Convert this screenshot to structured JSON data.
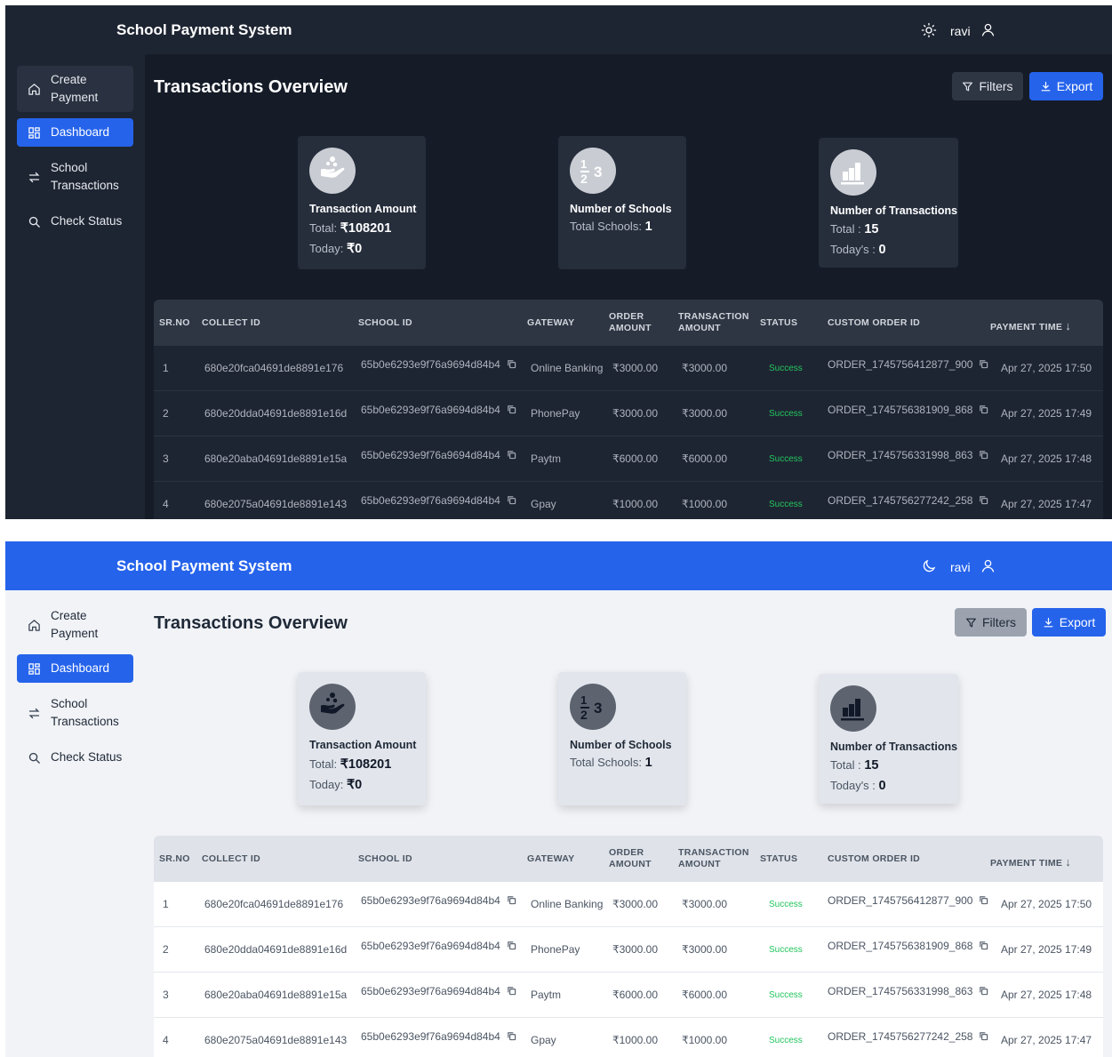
{
  "app_title": "School Payment System",
  "user": {
    "name": "ravi"
  },
  "sidebar": {
    "items": [
      {
        "label": "Create Payment",
        "icon": "home-icon"
      },
      {
        "label": "Dashboard",
        "icon": "dashboard-icon"
      },
      {
        "label": "School Transactions",
        "icon": "arrows-swap-icon"
      },
      {
        "label": "Check Status",
        "icon": "search-icon"
      }
    ]
  },
  "page_title": "Transactions Overview",
  "toolbar": {
    "filters_label": "Filters",
    "export_label": "Export"
  },
  "cards": {
    "amount": {
      "title": "Transaction Amount",
      "total_label": "Total:",
      "total_value": "₹108201",
      "today_label": "Today:",
      "today_value": "₹0"
    },
    "schools": {
      "title": "Number of Schools",
      "total_label": "Total Schools:",
      "total_value": "1"
    },
    "transactions": {
      "title": "Number of Transactions",
      "total_label": "Total :",
      "total_value": "15",
      "today_label": "Today's :",
      "today_value": "0"
    }
  },
  "table": {
    "headers": {
      "srno": "SR.NO",
      "collect_id": "COLLECT ID",
      "school_id": "SCHOOL ID",
      "gateway": "GATEWAY",
      "order_amount": "ORDER AMOUNT",
      "transaction_amount": "TRANSACTION AMOUNT",
      "status": "STATUS",
      "custom_order_id": "CUSTOM ORDER ID",
      "payment_time": "PAYMENT TIME"
    },
    "rows": [
      {
        "srno": "1",
        "collect_id": "680e20fca04691de8891e176",
        "school_id": "65b0e6293e9f76a9694d84b4",
        "gateway": "Online Banking",
        "order_amount": "₹3000.00",
        "transaction_amount": "₹3000.00",
        "status": "Success",
        "custom_order_id": "ORDER_1745756412877_900",
        "payment_time": "Apr 27, 2025 17:50"
      },
      {
        "srno": "2",
        "collect_id": "680e20dda04691de8891e16d",
        "school_id": "65b0e6293e9f76a9694d84b4",
        "gateway": "PhonePay",
        "order_amount": "₹3000.00",
        "transaction_amount": "₹3000.00",
        "status": "Success",
        "custom_order_id": "ORDER_1745756381909_868",
        "payment_time": "Apr 27, 2025 17:49"
      },
      {
        "srno": "3",
        "collect_id": "680e20aba04691de8891e15a",
        "school_id": "65b0e6293e9f76a9694d84b4",
        "gateway": "Paytm",
        "order_amount": "₹6000.00",
        "transaction_amount": "₹6000.00",
        "status": "Success",
        "custom_order_id": "ORDER_1745756331998_863",
        "payment_time": "Apr 27, 2025 17:48"
      },
      {
        "srno": "4",
        "collect_id": "680e2075a04691de8891e143",
        "school_id": "65b0e6293e9f76a9694d84b4",
        "gateway": "Gpay",
        "order_amount": "₹1000.00",
        "transaction_amount": "₹1000.00",
        "status": "Success",
        "custom_order_id": "ORDER_1745756277242_258",
        "payment_time": "Apr 27, 2025 17:47"
      }
    ]
  },
  "colors": {
    "accent": "#2563eb",
    "success": "#22c55e",
    "dark_bg": "#151c28",
    "light_bg": "#f1f3f7"
  }
}
